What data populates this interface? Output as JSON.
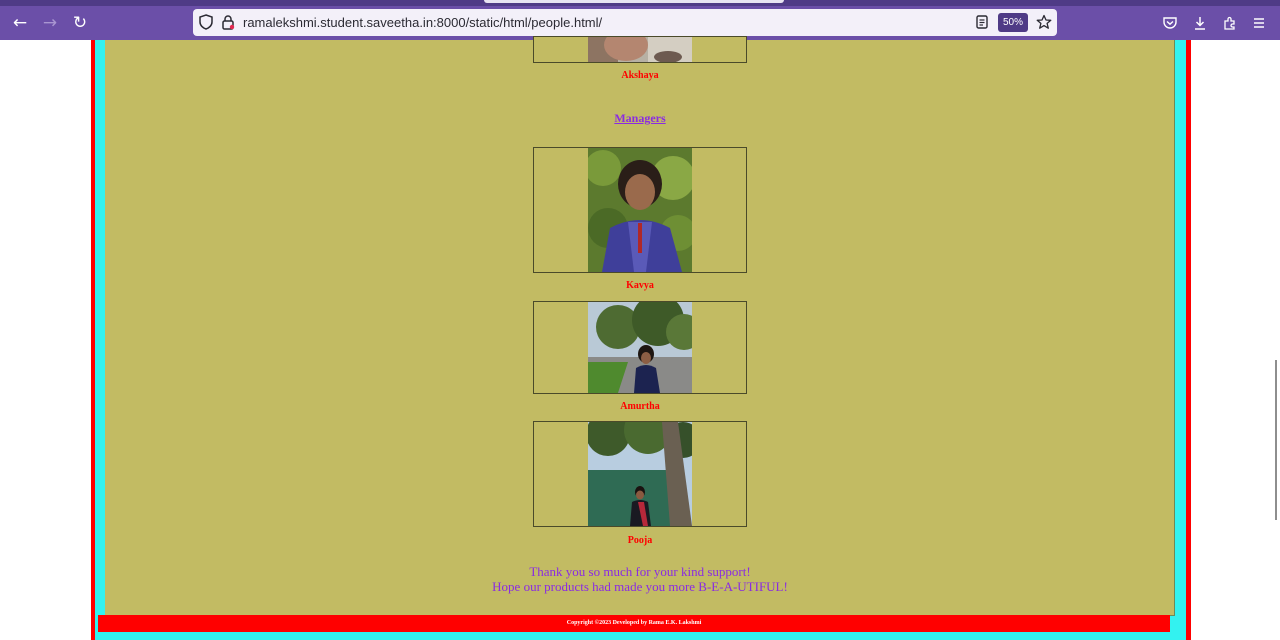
{
  "browser": {
    "url": "ramalekshmi.student.saveetha.in:8000/static/html/people.html/",
    "zoom": "50%",
    "icons": [
      "back-icon",
      "forward-icon",
      "reload-icon",
      "shield-icon",
      "lock-icon",
      "reader-icon",
      "star-icon",
      "pocket-icon",
      "download-icon",
      "extensions-icon",
      "menu-icon"
    ],
    "theme_color": "#6b4fa8"
  },
  "page": {
    "colors": {
      "outer": "#ff0000",
      "border": "#33f2f0",
      "background": "#c2bb63",
      "name": "#ff0000",
      "accent": "#8a2be2"
    },
    "previous_person": {
      "name": "Akshaya"
    },
    "managers_heading": "Managers",
    "managers": [
      {
        "name": "Kavya"
      },
      {
        "name": "Amurtha"
      },
      {
        "name": "Pooja"
      }
    ],
    "thanks_line1": "Thank you so much for your kind support!",
    "thanks_line2": "Hope our products had made you more B-E-A-UTIFUL!",
    "footer": "Copyright ©2023 Developed by Rama E.K. Lakshmi"
  }
}
